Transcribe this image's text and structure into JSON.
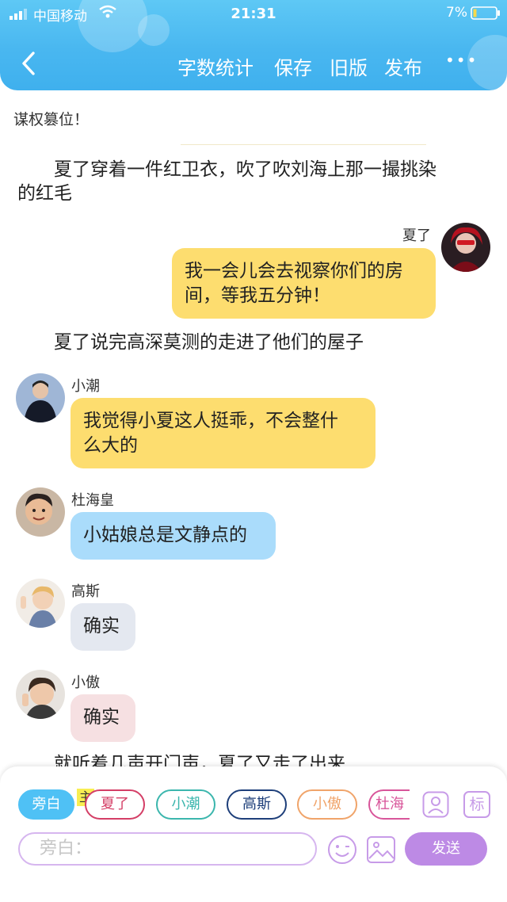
{
  "status_bar": {
    "carrier": "中国移动",
    "time": "21:31",
    "battery": "7%"
  },
  "toolbar": {
    "word_count": "字数统计",
    "save": "保存",
    "old_version": "旧版",
    "publish": "发布",
    "more": "•••"
  },
  "story": {
    "title_line": "谋权篡位！",
    "narrations": [
      "夏了穿着一件红卫衣，吹了吹刘海上那一撮挑染",
      "的红毛",
      "夏了说完高深莫测的走进了他们的屋子",
      "就听着几声开门声，夏了又走了出来"
    ],
    "messages": [
      {
        "name": "夏了",
        "lines": [
          "我一会儿会去视察你们的房",
          "间，等我五分钟！"
        ],
        "bubble_color": "#fddd6f"
      },
      {
        "name": "小潮",
        "lines": [
          "我觉得小夏这人挺乖，不会整什",
          "么大的"
        ],
        "bubble_color": "#fddd6f"
      },
      {
        "name": "杜海皇",
        "lines": [
          "小姑娘总是文静点的"
        ],
        "bubble_color": "#aadcfb"
      },
      {
        "name": "高斯",
        "lines": [
          "确实"
        ],
        "bubble_color": "#e4e8f0"
      },
      {
        "name": "小傲",
        "lines": [
          "确实"
        ],
        "bubble_color": "#f6e0e2"
      }
    ]
  },
  "roles": [
    {
      "label": "旁白",
      "selected": true,
      "color": "#4fc1f5"
    },
    {
      "label": "夏了",
      "badge": "主",
      "color": "#d43e66"
    },
    {
      "label": "小潮",
      "color": "#3bb6ad"
    },
    {
      "label": "高斯",
      "color": "#1e3f7a"
    },
    {
      "label": "小傲",
      "color": "#f0a46a"
    },
    {
      "label": "杜海",
      "color": "#d8559a"
    }
  ],
  "side_buttons": {
    "mark": "标"
  },
  "composer": {
    "placeholder": "旁白：",
    "send": "发送"
  }
}
